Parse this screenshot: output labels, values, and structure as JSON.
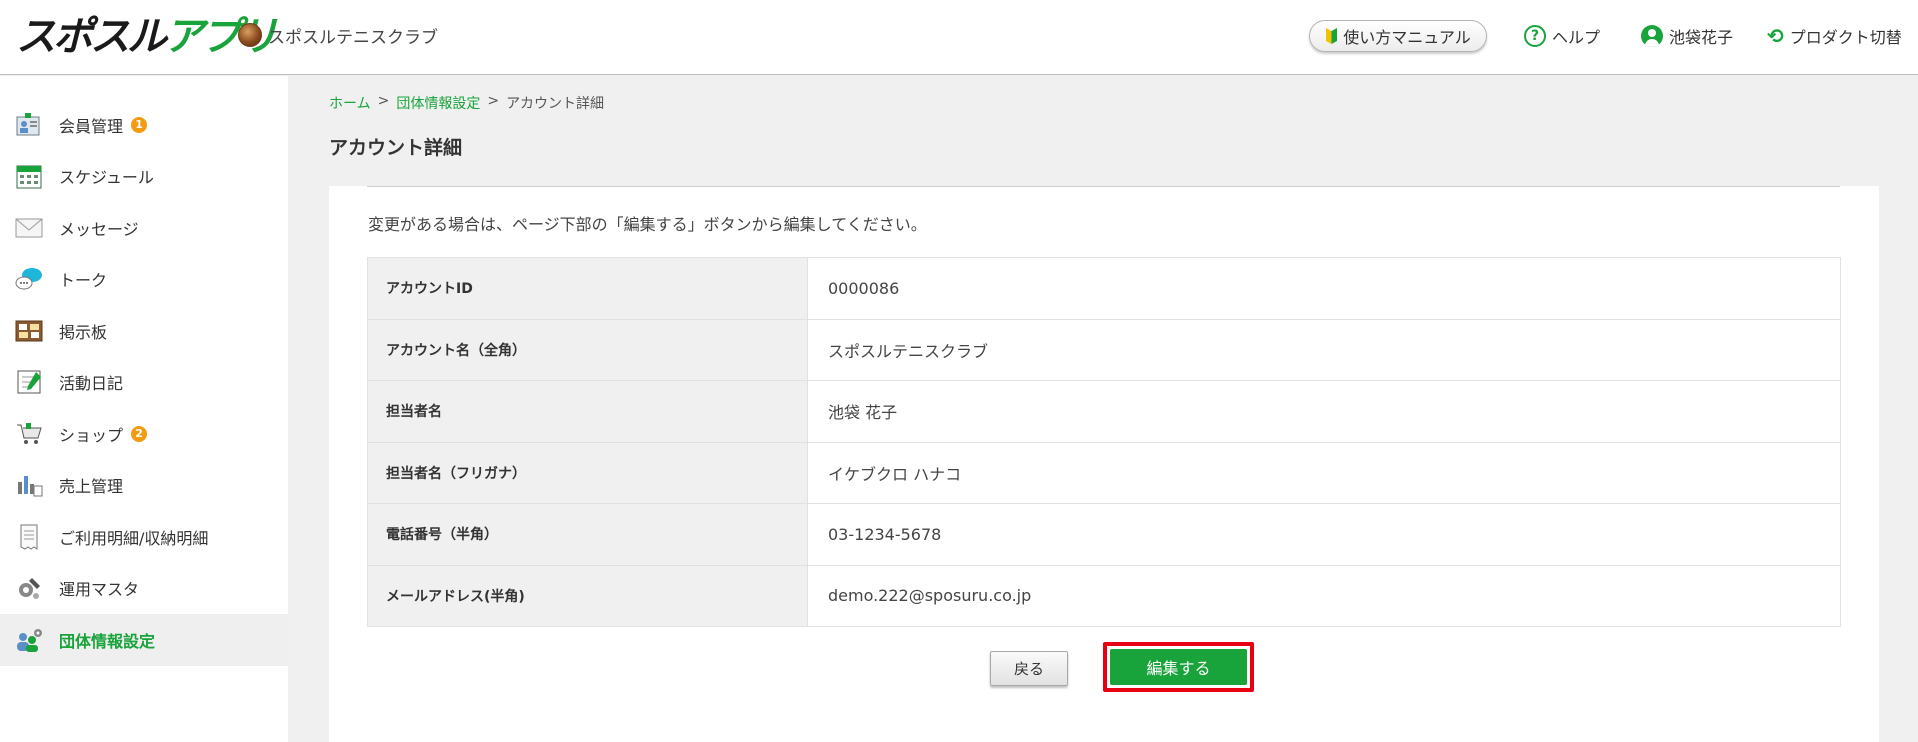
{
  "header": {
    "logo_part1": "スポスル",
    "logo_part2": "アプリ",
    "org_name": "スポスルテニスクラブ",
    "manual_label": "使い方マニュアル",
    "help_label": "ヘルプ",
    "user_name": "池袋花子",
    "product_switch_label": "プロダクト切替"
  },
  "sidebar": {
    "items": [
      {
        "label": "会員管理",
        "icon": "member-card-icon",
        "badge": "1"
      },
      {
        "label": "スケジュール",
        "icon": "calendar-icon"
      },
      {
        "label": "メッセージ",
        "icon": "envelope-icon"
      },
      {
        "label": "トーク",
        "icon": "chat-bubble-icon"
      },
      {
        "label": "掲示板",
        "icon": "bulletin-board-icon"
      },
      {
        "label": "活動日記",
        "icon": "notebook-icon"
      },
      {
        "label": "ショップ",
        "icon": "shopping-cart-icon",
        "badge": "2"
      },
      {
        "label": "売上管理",
        "icon": "sales-chart-icon"
      },
      {
        "label": "ご利用明細/収納明細",
        "icon": "receipt-icon"
      },
      {
        "label": "運用マスタ",
        "icon": "gear-wrench-icon"
      },
      {
        "label": "団体情報設定",
        "icon": "group-settings-icon",
        "active": true
      }
    ]
  },
  "breadcrumb": {
    "home": "ホーム",
    "sep": ">",
    "parent": "団体情報設定",
    "current": "アカウント詳細"
  },
  "page": {
    "title": "アカウント詳細",
    "notice": "変更がある場合は、ページ下部の「編集する」ボタンから編集してください。"
  },
  "details": [
    {
      "label": "アカウントID",
      "value": "0000086"
    },
    {
      "label": "アカウント名（全角）",
      "value": "スポスルテニスクラブ"
    },
    {
      "label": "担当者名",
      "value": "池袋 花子"
    },
    {
      "label": "担当者名（フリガナ）",
      "value": "イケブクロ ハナコ"
    },
    {
      "label": "電話番号（半角）",
      "value": "03-1234-5678"
    },
    {
      "label": "メールアドレス(半角)",
      "value": "demo.222@sposuru.co.jp"
    }
  ],
  "buttons": {
    "back": "戻る",
    "edit": "編集する"
  },
  "colors": {
    "brand_green": "#19a33b",
    "highlight_red": "#e60012",
    "badge_orange": "#f39c12"
  }
}
